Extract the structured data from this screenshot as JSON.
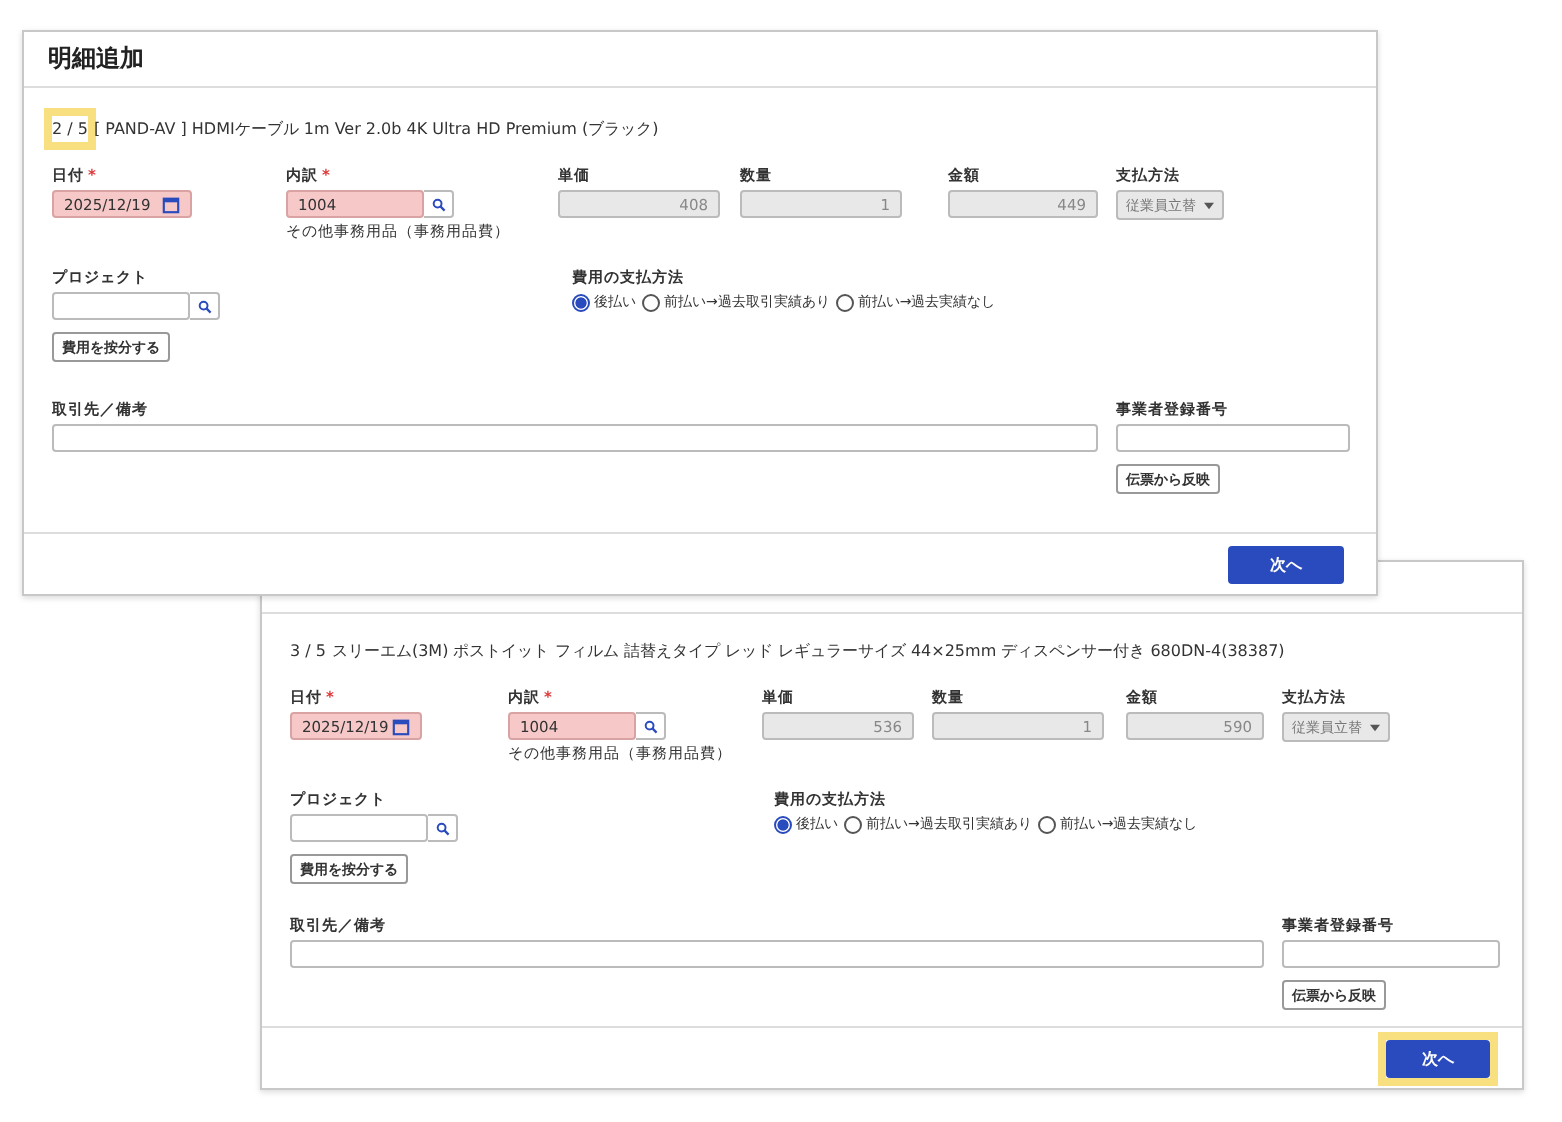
{
  "dialogs": [
    {
      "title": "明細追加",
      "counter": {
        "text": "2 / 5",
        "highlighted": true
      },
      "item_name": "[ PAND-AV ] HDMIケーブル 1m Ver 2.0b 4K Ultra HD Premium (ブラック)",
      "date": {
        "label": "日付",
        "required_mark": "*",
        "value": "2025/12/19"
      },
      "breakdown": {
        "label": "内訳",
        "required_mark": "*",
        "value": "1004",
        "caption": "その他事務用品（事務用品費）"
      },
      "unit_price": {
        "label": "単価",
        "value": "408"
      },
      "quantity": {
        "label": "数量",
        "value": "1"
      },
      "amount": {
        "label": "金額",
        "value": "449"
      },
      "payment_method": {
        "label": "支払方法",
        "value": "従業員立替"
      },
      "project": {
        "label": "プロジェクト",
        "button": "費用を按分する"
      },
      "expense_payment": {
        "label": "費用の支払方法",
        "options": [
          {
            "label": "後払い",
            "selected": true
          },
          {
            "label": "前払い→過去取引実績あり",
            "selected": false
          },
          {
            "label": "前払い→過去実績なし",
            "selected": false
          }
        ]
      },
      "partner": {
        "label": "取引先／備考"
      },
      "registration": {
        "label": "事業者登録番号",
        "button": "伝票から反映"
      },
      "next_button": {
        "label": "次へ",
        "highlighted": false
      }
    },
    {
      "counter": {
        "text": "3 / 5",
        "highlighted": false
      },
      "item_name": "スリーエム(3M) ポストイット フィルム 詰替えタイプ レッド レギュラーサイズ 44×25mm ディスペンサー付き 680DN-4(38387)",
      "date": {
        "label": "日付",
        "required_mark": "*",
        "value": "2025/12/19"
      },
      "breakdown": {
        "label": "内訳",
        "required_mark": "*",
        "value": "1004",
        "caption": "その他事務用品（事務用品費）"
      },
      "unit_price": {
        "label": "単価",
        "value": "536"
      },
      "quantity": {
        "label": "数量",
        "value": "1"
      },
      "amount": {
        "label": "金額",
        "value": "590"
      },
      "payment_method": {
        "label": "支払方法",
        "value": "従業員立替"
      },
      "project": {
        "label": "プロジェクト",
        "button": "費用を按分する"
      },
      "expense_payment": {
        "label": "費用の支払方法",
        "options": [
          {
            "label": "後払い",
            "selected": true
          },
          {
            "label": "前払い→過去取引実績あり",
            "selected": false
          },
          {
            "label": "前払い→過去実績なし",
            "selected": false
          }
        ]
      },
      "partner": {
        "label": "取引先／備考"
      },
      "registration": {
        "label": "事業者登録番号",
        "button": "伝票から反映"
      },
      "next_button": {
        "label": "次へ",
        "highlighted": true
      }
    }
  ]
}
